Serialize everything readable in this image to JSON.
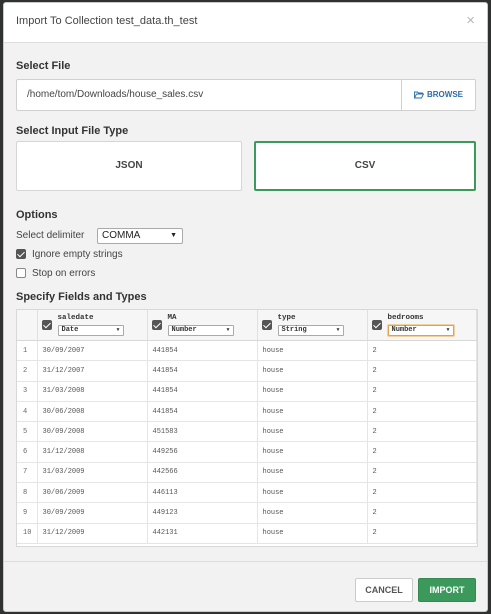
{
  "dialog": {
    "title": "Import To Collection test_data.th_test",
    "close_glyph": "×"
  },
  "file": {
    "section_label": "Select File",
    "path": "/home/tom/Downloads/house_sales.csv",
    "browse_label": "BROWSE",
    "browse_icon": "folder-open-icon"
  },
  "file_type": {
    "section_label": "Select Input File Type",
    "options": [
      "JSON",
      "CSV"
    ],
    "selected": "CSV"
  },
  "options": {
    "section_label": "Options",
    "delimiter_label": "Select delimiter",
    "delimiter_value": "COMMA",
    "ignore_empty_label": "Ignore empty strings",
    "ignore_empty_checked": true,
    "stop_on_errors_label": "Stop on errors",
    "stop_on_errors_checked": false
  },
  "fields": {
    "section_label": "Specify Fields and Types",
    "columns": [
      {
        "name": "saledate",
        "type": "Date",
        "checked": true
      },
      {
        "name": "MA",
        "type": "Number",
        "checked": true
      },
      {
        "name": "type",
        "type": "String",
        "checked": true
      },
      {
        "name": "bedrooms",
        "type": "Number",
        "checked": true
      }
    ],
    "rows": [
      {
        "idx": "1",
        "saledate": "30/09/2007",
        "MA": "441854",
        "type": "house",
        "bedrooms": "2"
      },
      {
        "idx": "2",
        "saledate": "31/12/2007",
        "MA": "441854",
        "type": "house",
        "bedrooms": "2"
      },
      {
        "idx": "3",
        "saledate": "31/03/2008",
        "MA": "441854",
        "type": "house",
        "bedrooms": "2"
      },
      {
        "idx": "4",
        "saledate": "30/06/2008",
        "MA": "441854",
        "type": "house",
        "bedrooms": "2"
      },
      {
        "idx": "5",
        "saledate": "30/09/2008",
        "MA": "451583",
        "type": "house",
        "bedrooms": "2"
      },
      {
        "idx": "6",
        "saledate": "31/12/2008",
        "MA": "449256",
        "type": "house",
        "bedrooms": "2"
      },
      {
        "idx": "7",
        "saledate": "31/03/2009",
        "MA": "442566",
        "type": "house",
        "bedrooms": "2"
      },
      {
        "idx": "8",
        "saledate": "30/06/2009",
        "MA": "446113",
        "type": "house",
        "bedrooms": "2"
      },
      {
        "idx": "9",
        "saledate": "30/09/2009",
        "MA": "449123",
        "type": "house",
        "bedrooms": "2"
      },
      {
        "idx": "10",
        "saledate": "31/12/2009",
        "MA": "442131",
        "type": "house",
        "bedrooms": "2"
      }
    ]
  },
  "footer": {
    "cancel_label": "CANCEL",
    "import_label": "IMPORT"
  },
  "colors": {
    "accent_green": "#3b9a5b",
    "link_blue": "#2d6ca8"
  }
}
